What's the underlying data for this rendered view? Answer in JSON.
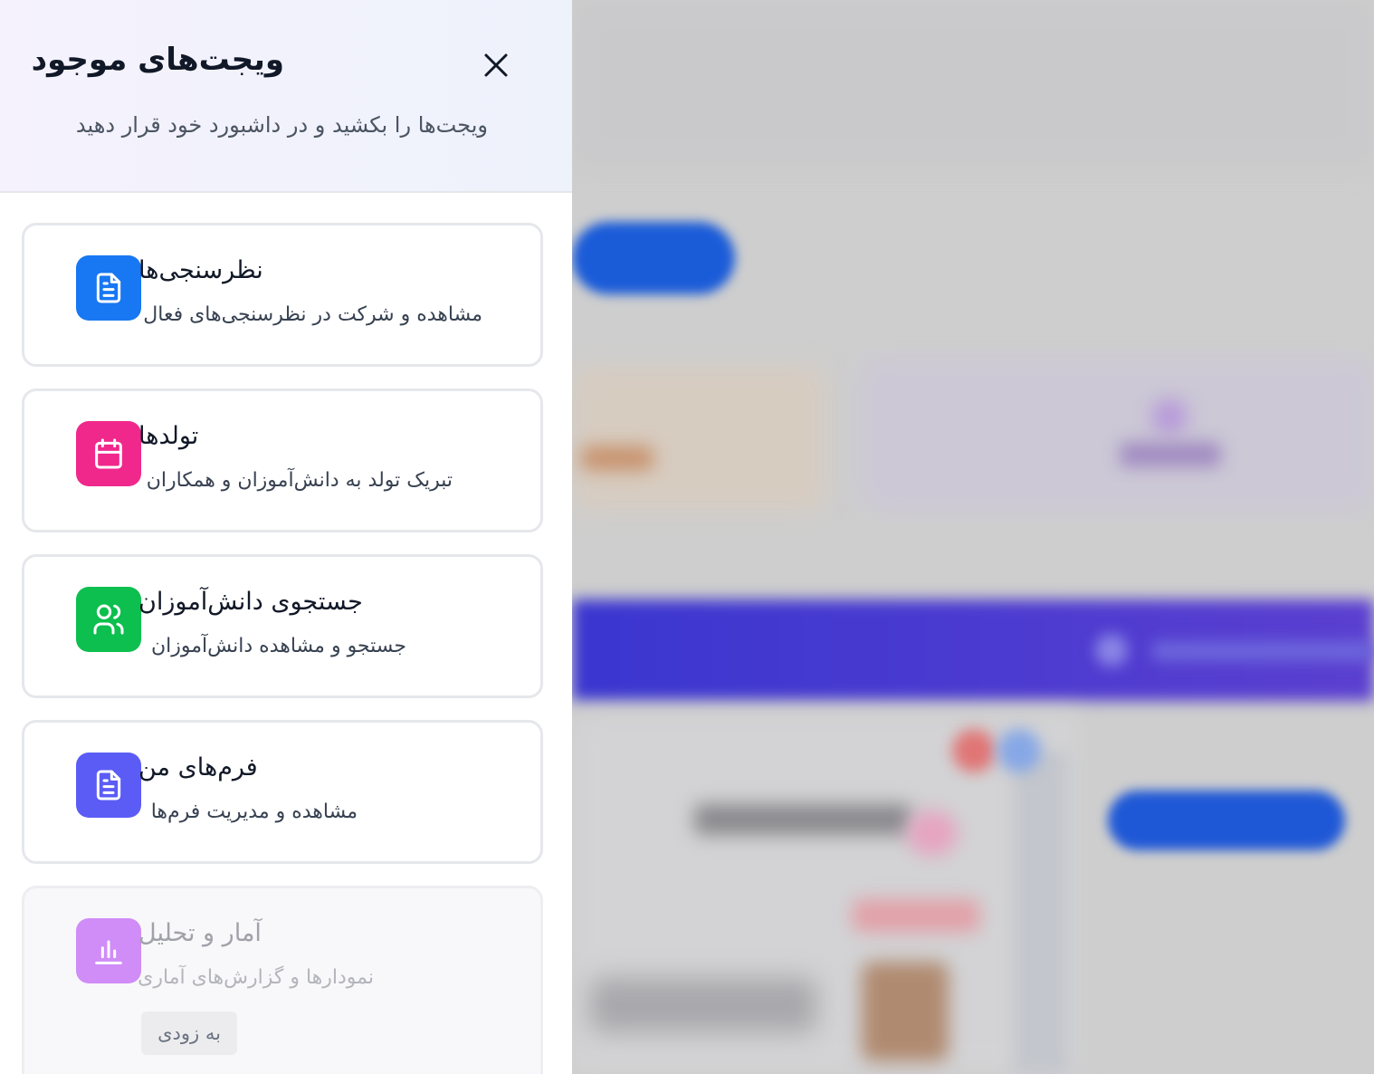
{
  "drawer": {
    "title": "ویجت‌های موجود",
    "subtitle": "ویجت‌ها را بکشید و در داشبورد خود قرار دهید",
    "close_icon": "close-icon"
  },
  "widgets": [
    {
      "title": "نظرسنجی‌ها",
      "description": "مشاهده و شرکت در نظرسنجی‌های فعال",
      "icon": "document-icon",
      "color": "#1877f2"
    },
    {
      "title": "تولدها",
      "description": "تبریک تولد به دانش‌آموزان و همکاران",
      "icon": "calendar-icon",
      "color": "#f0288c"
    },
    {
      "title": "جستجوی دانش‌آموزان",
      "description": "جستجو و مشاهده دانش‌آموزان",
      "icon": "users-icon",
      "color": "#0dbf4e"
    },
    {
      "title": "فرم‌های من",
      "description": "مشاهده و مدیریت فرم‌ها",
      "icon": "document-icon",
      "color": "#5b5cf6"
    },
    {
      "title": "آمار و تحلیل",
      "description": "نمودارها و گزارش‌های آماری",
      "icon": "bar-chart-icon",
      "color": "#d08cf7",
      "badge": "به زودی"
    }
  ]
}
